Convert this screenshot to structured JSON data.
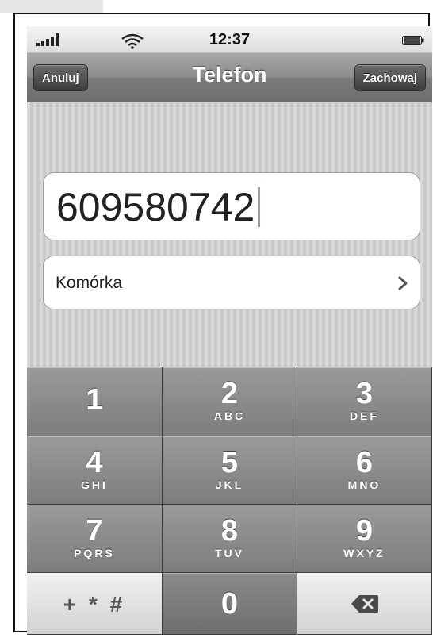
{
  "status_bar": {
    "time": "12:37"
  },
  "nav": {
    "title": "Telefon",
    "cancel_label": "Anuluj",
    "save_label": "Zachowaj"
  },
  "form": {
    "phone_value": "609580742",
    "label_type": "Komórka"
  },
  "keypad": {
    "keys": [
      {
        "digit": "1",
        "letters": ""
      },
      {
        "digit": "2",
        "letters": "ABC"
      },
      {
        "digit": "3",
        "letters": "DEF"
      },
      {
        "digit": "4",
        "letters": "GHI"
      },
      {
        "digit": "5",
        "letters": "JKL"
      },
      {
        "digit": "6",
        "letters": "MNO"
      },
      {
        "digit": "7",
        "letters": "PQRS"
      },
      {
        "digit": "8",
        "letters": "TUV"
      },
      {
        "digit": "9",
        "letters": "WXYZ"
      }
    ],
    "symbols_label": "+ * #",
    "zero": "0"
  },
  "icons": {
    "signal": "signal-bars-icon",
    "wifi": "wifi-icon",
    "battery": "battery-icon",
    "chevron": "chevron-right-icon",
    "backspace": "backspace-icon"
  }
}
